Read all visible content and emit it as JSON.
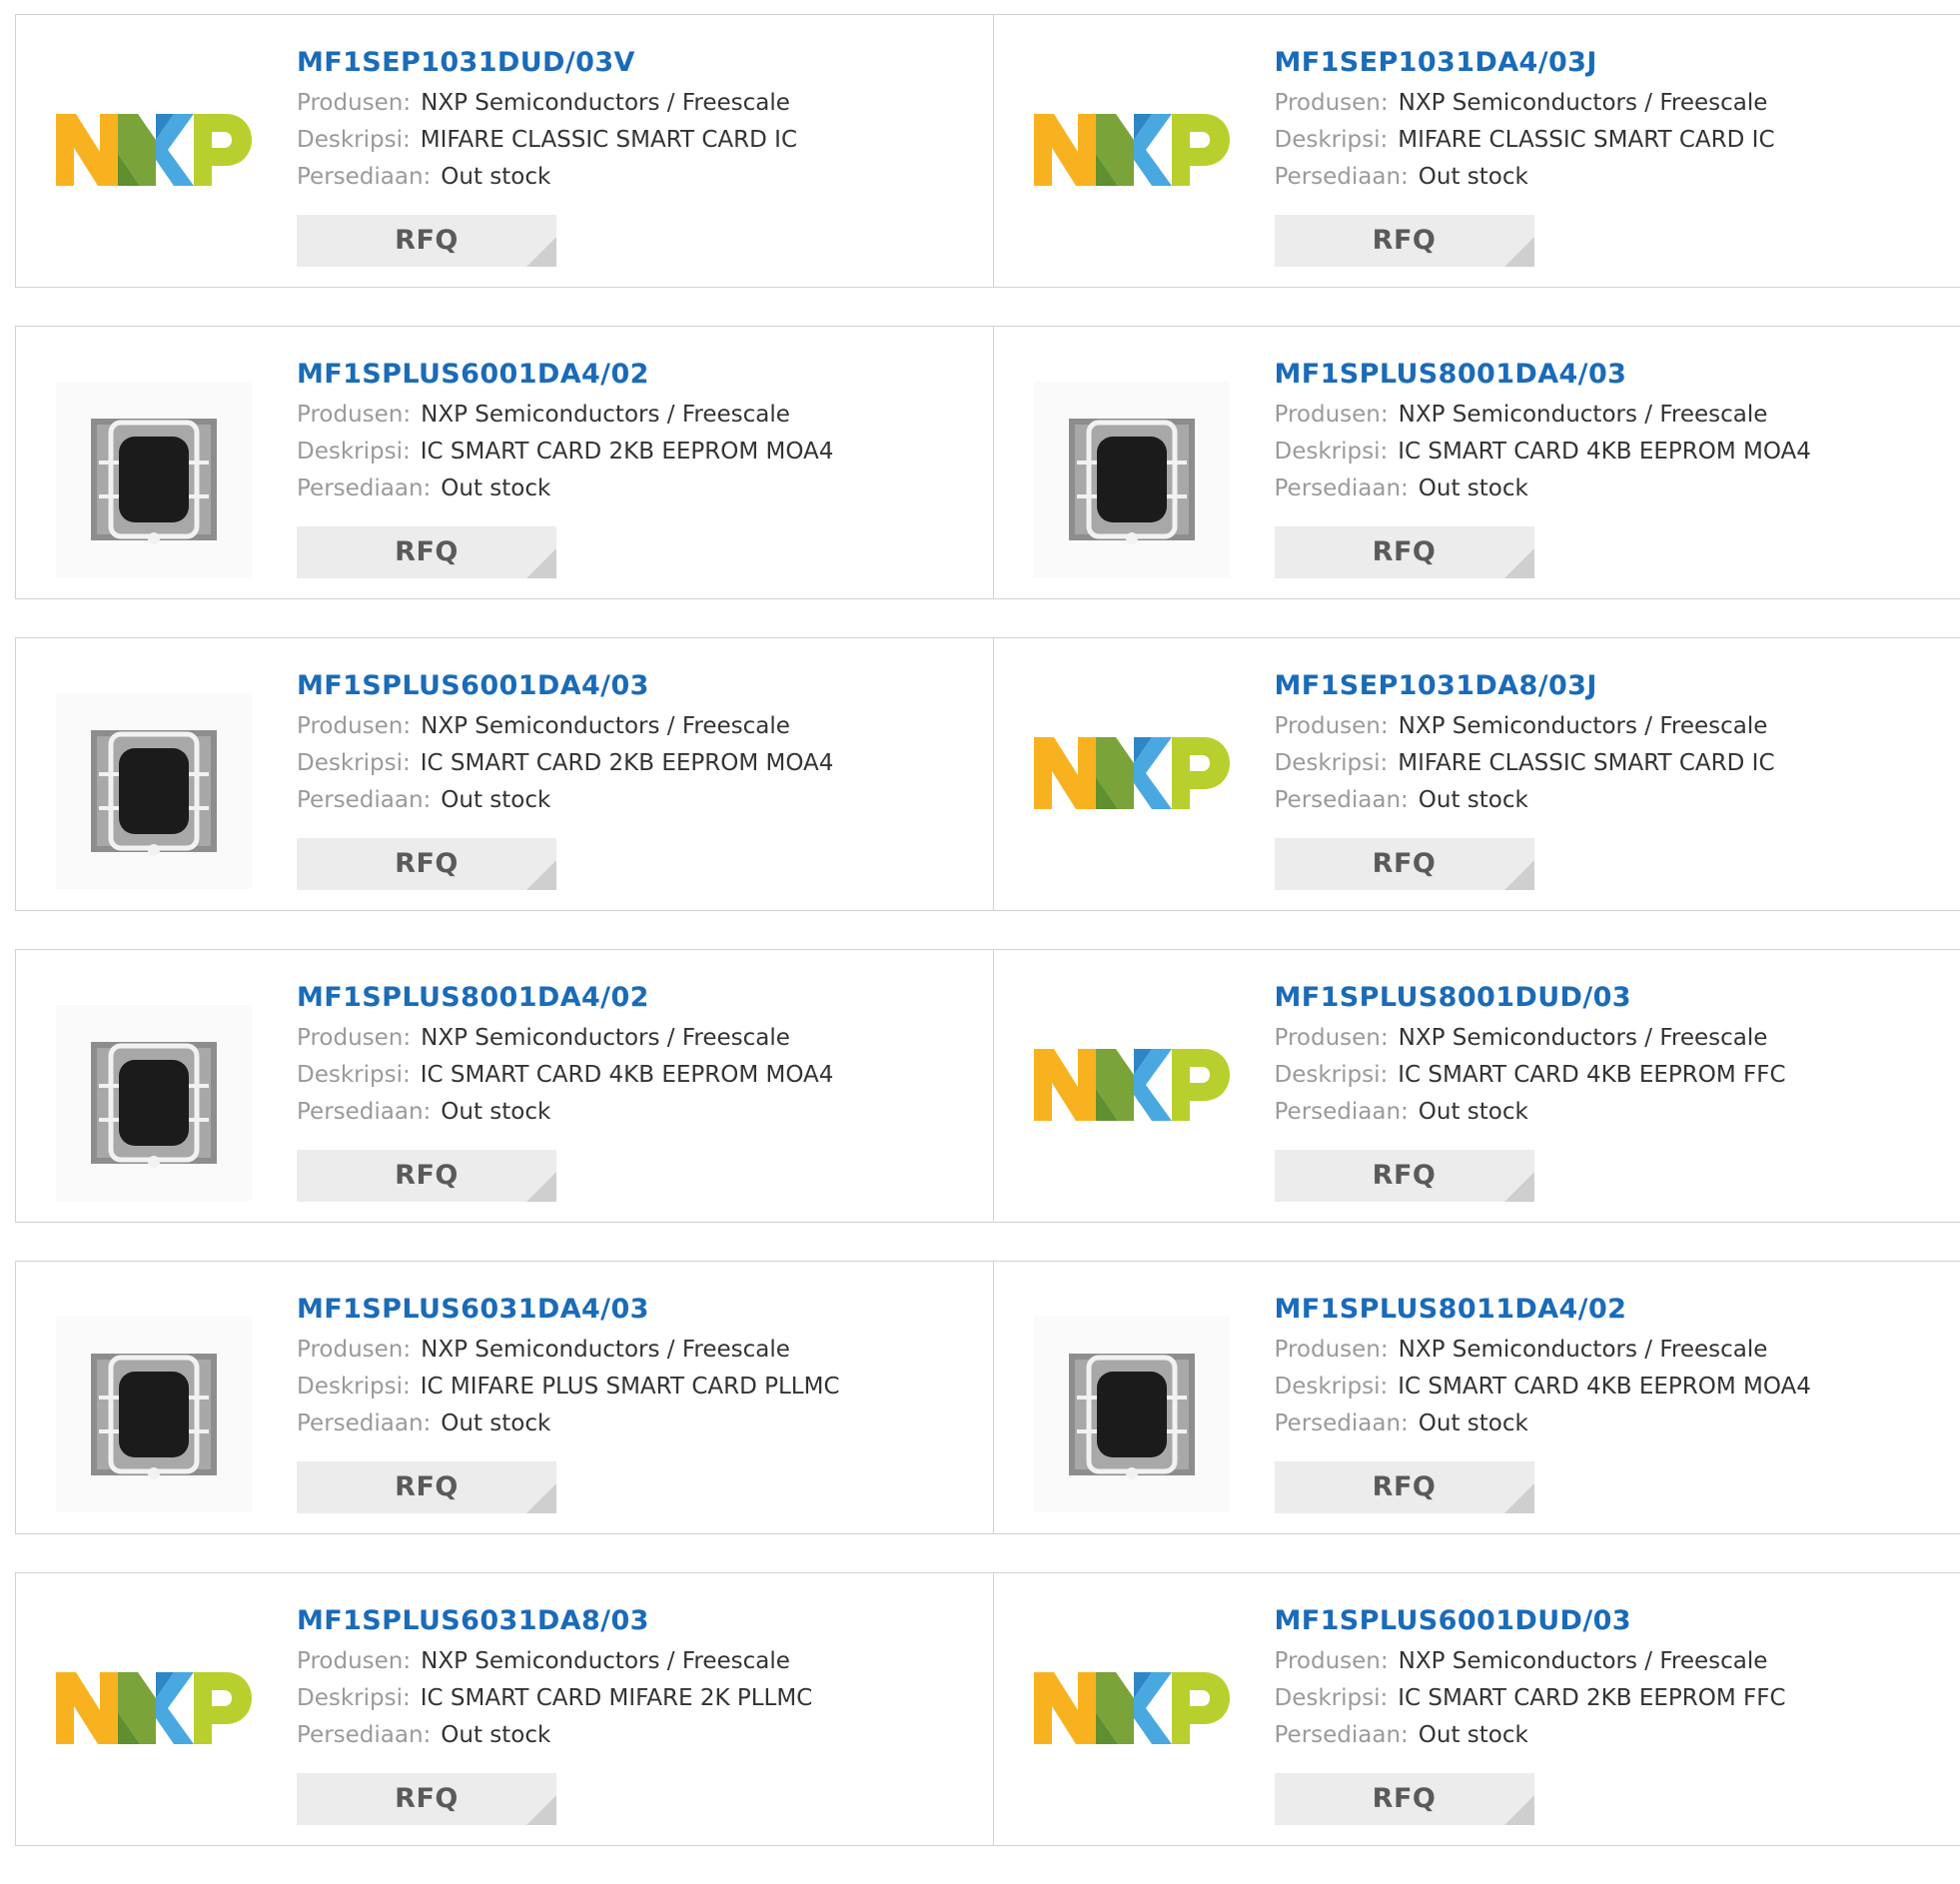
{
  "labels": {
    "manufacturer": "Produsen:",
    "description": "Deskripsi:",
    "stock": "Persediaan:",
    "rfq": "RFQ"
  },
  "logo_colors": {
    "n": "#f9b21f",
    "x_left": "#7aa33a",
    "x_right": "#4aa8e0",
    "p": "#b9cf2d"
  },
  "products": [
    {
      "part": "MF1SEP1031DUD/03V",
      "manufacturer": "NXP Semiconductors / Freescale",
      "description": "MIFARE CLASSIC SMART CARD IC",
      "stock": "Out stock",
      "image": "nxp-logo"
    },
    {
      "part": "MF1SEP1031DA4/03J",
      "manufacturer": "NXP Semiconductors / Freescale",
      "description": "MIFARE CLASSIC SMART CARD IC",
      "stock": "Out stock",
      "image": "nxp-logo"
    },
    {
      "part": "MF1SPLUS6001DA4/02",
      "manufacturer": "NXP Semiconductors / Freescale",
      "description": "IC SMART CARD 2KB EEPROM MOA4",
      "stock": "Out stock",
      "image": "chip-module"
    },
    {
      "part": "MF1SPLUS8001DA4/03",
      "manufacturer": "NXP Semiconductors / Freescale",
      "description": "IC SMART CARD 4KB EEPROM MOA4",
      "stock": "Out stock",
      "image": "chip-module"
    },
    {
      "part": "MF1SPLUS6001DA4/03",
      "manufacturer": "NXP Semiconductors / Freescale",
      "description": "IC SMART CARD 2KB EEPROM MOA4",
      "stock": "Out stock",
      "image": "chip-module"
    },
    {
      "part": "MF1SEP1031DA8/03J",
      "manufacturer": "NXP Semiconductors / Freescale",
      "description": "MIFARE CLASSIC SMART CARD IC",
      "stock": "Out stock",
      "image": "nxp-logo"
    },
    {
      "part": "MF1SPLUS8001DA4/02",
      "manufacturer": "NXP Semiconductors / Freescale",
      "description": "IC SMART CARD 4KB EEPROM MOA4",
      "stock": "Out stock",
      "image": "chip-module"
    },
    {
      "part": "MF1SPLUS8001DUD/03",
      "manufacturer": "NXP Semiconductors / Freescale",
      "description": "IC SMART CARD 4KB EEPROM FFC",
      "stock": "Out stock",
      "image": "nxp-logo"
    },
    {
      "part": "MF1SPLUS6031DA4/03",
      "manufacturer": "NXP Semiconductors / Freescale",
      "description": "IC MIFARE PLUS SMART CARD PLLMC",
      "stock": "Out stock",
      "image": "chip-module"
    },
    {
      "part": "MF1SPLUS8011DA4/02",
      "manufacturer": "NXP Semiconductors / Freescale",
      "description": "IC SMART CARD 4KB EEPROM MOA4",
      "stock": "Out stock",
      "image": "chip-module"
    },
    {
      "part": "MF1SPLUS6031DA8/03",
      "manufacturer": "NXP Semiconductors / Freescale",
      "description": "IC SMART CARD MIFARE 2K PLLMC",
      "stock": "Out stock",
      "image": "nxp-logo"
    },
    {
      "part": "MF1SPLUS6001DUD/03",
      "manufacturer": "NXP Semiconductors / Freescale",
      "description": "IC SMART CARD 2KB EEPROM FFC",
      "stock": "Out stock",
      "image": "nxp-logo"
    }
  ]
}
